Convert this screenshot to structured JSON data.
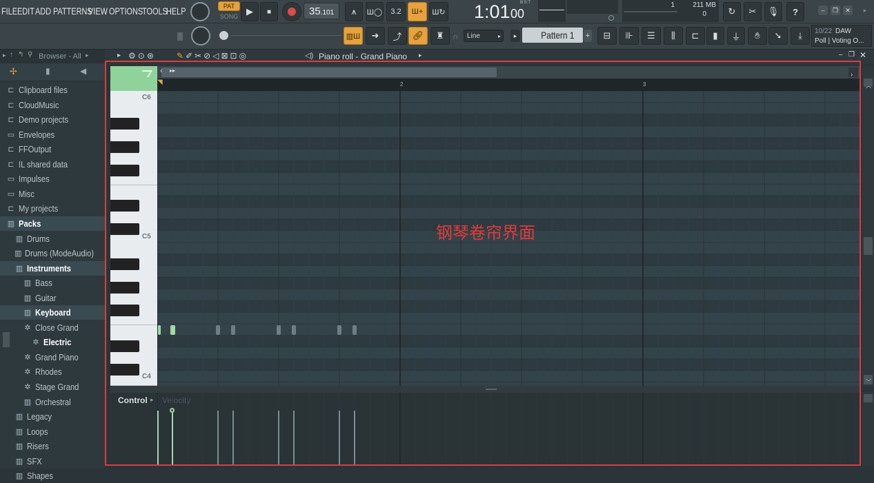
{
  "menu": [
    "FILE",
    "EDIT",
    "ADD",
    "PATTERNS",
    "VIEW",
    "OPTIONS",
    "TOOLS",
    "HELP"
  ],
  "transport": {
    "pat_label": "PAT",
    "song_label": "SONG",
    "tempo_int": "35",
    "tempo_frac": ".101",
    "time_main": "1:01",
    "time_sub": "00",
    "time_caption": "B:S:T",
    "cpu_value": "1",
    "memory": "211 MB",
    "memory_sub": "0"
  },
  "toolbar2": {
    "snap_mode": "Line",
    "pattern_name": "Pattern 1",
    "news_date": "10/22",
    "news_source": "DAW",
    "news_text": "Poll | Voting O..."
  },
  "browser": {
    "header": "Browser - All",
    "items": [
      {
        "label": "Clipboard files",
        "icon": "folder-link-icon",
        "indent": 0,
        "style": ""
      },
      {
        "label": "CloudMusic",
        "icon": "folder-link-icon",
        "indent": 0,
        "style": ""
      },
      {
        "label": "Demo projects",
        "icon": "folder-link-icon",
        "indent": 0,
        "style": ""
      },
      {
        "label": "Envelopes",
        "icon": "folder-icon",
        "indent": 0,
        "style": ""
      },
      {
        "label": "FFOutput",
        "icon": "folder-link-icon",
        "indent": 0,
        "style": ""
      },
      {
        "label": "IL shared data",
        "icon": "folder-link-icon",
        "indent": 0,
        "style": ""
      },
      {
        "label": "Impulses",
        "icon": "folder-icon",
        "indent": 0,
        "style": ""
      },
      {
        "label": "Misc",
        "icon": "folder-icon",
        "indent": 0,
        "style": ""
      },
      {
        "label": "My projects",
        "icon": "folder-link-icon",
        "indent": 0,
        "style": ""
      },
      {
        "label": "Packs",
        "icon": "pack-icon",
        "indent": 0,
        "style": "hl"
      },
      {
        "label": "Drums",
        "icon": "pack-icon",
        "indent": 1,
        "style": ""
      },
      {
        "label": "Drums (ModeAudio)",
        "icon": "pack-icon",
        "indent": 1,
        "style": ""
      },
      {
        "label": "Instruments",
        "icon": "pack-icon",
        "indent": 1,
        "style": "hl"
      },
      {
        "label": "Bass",
        "icon": "pack-icon",
        "indent": 2,
        "style": ""
      },
      {
        "label": "Guitar",
        "icon": "pack-icon",
        "indent": 2,
        "style": ""
      },
      {
        "label": "Keyboard",
        "icon": "pack-icon",
        "indent": 2,
        "style": "hl"
      },
      {
        "label": "Close Grand",
        "icon": "preset-icon",
        "indent": 2,
        "style": ""
      },
      {
        "label": "Electric",
        "icon": "preset-icon",
        "indent": 3,
        "style": "sel"
      },
      {
        "label": "Grand Piano",
        "icon": "preset-icon",
        "indent": 2,
        "style": ""
      },
      {
        "label": "Rhodes",
        "icon": "preset-icon",
        "indent": 2,
        "style": ""
      },
      {
        "label": "Stage Grand",
        "icon": "preset-icon",
        "indent": 2,
        "style": ""
      },
      {
        "label": "Orchestral",
        "icon": "pack-icon",
        "indent": 2,
        "style": ""
      },
      {
        "label": "Legacy",
        "icon": "pack-icon",
        "indent": 1,
        "style": ""
      },
      {
        "label": "Loops",
        "icon": "pack-icon",
        "indent": 1,
        "style": ""
      },
      {
        "label": "Risers",
        "icon": "pack-icon",
        "indent": 1,
        "style": ""
      },
      {
        "label": "SFX",
        "icon": "pack-icon",
        "indent": 1,
        "style": ""
      },
      {
        "label": "Shapes",
        "icon": "pack-icon",
        "indent": 1,
        "style": ""
      }
    ]
  },
  "piano_roll": {
    "title": "Piano roll - Grand Piano",
    "bar_markers": [
      "2",
      "3"
    ],
    "key_labels": [
      "C6",
      "C5",
      "C4"
    ],
    "annotation": "钢琴卷帘界面",
    "control_label": "Control",
    "control_target": "Velocity"
  },
  "colors": {
    "accent": "#e7a23a",
    "note_active": "#9fd9a6",
    "note_ghost": "#6f7d84",
    "highlight_frame": "#e23a3a"
  }
}
